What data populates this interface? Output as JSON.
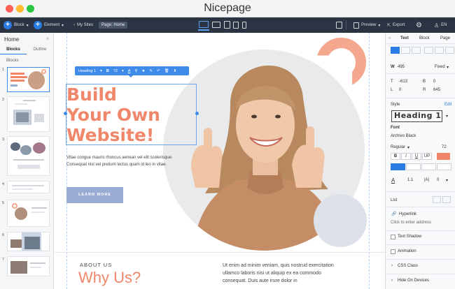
{
  "window": {
    "title": "Nicepage"
  },
  "toolbar": {
    "block_label": "Block",
    "element_label": "Element",
    "my_sites_label": "My Sites",
    "page_label": "Page: Home",
    "preview_label": "Preview",
    "export_label": "Export",
    "lang_label": "EN"
  },
  "left_panel": {
    "title": "Home",
    "tabs": [
      "Blocks",
      "Outline"
    ],
    "section_label": "Blocks",
    "thumbnails": [
      "1",
      "2",
      "3",
      "4",
      "5",
      "6",
      "7"
    ]
  },
  "canvas": {
    "heading_toolbar_label": "Heading 1",
    "heading_toolbar_size": "72",
    "heading_lines": [
      "Build",
      "Your Own",
      "Website!"
    ],
    "paragraph": "Vitae congue mauris rhoncus aenean vel elit scelerisque. Consequat nisl vel pretium lectus quam id leo in vitae.",
    "button_label": "LEARN MORE",
    "about_label": "ABOUT US",
    "why_heading": "Why Us?",
    "about_text": "Ut enim ad minim veniam, quis nostrud exercitation ullamco laboris nisi ut aliquip ex ea commodo consequat. Duis aute irure dolor in"
  },
  "right_panel": {
    "tabs": [
      "Text",
      "Block",
      "Page"
    ],
    "w_label": "W",
    "w_value": "495",
    "w_mode": "Fixed",
    "t_label": "T",
    "t_value": "-613",
    "b_label": "B",
    "b_value": "0",
    "l_label": "L",
    "l_value": "0",
    "r_label": "R",
    "r_value": "645",
    "style_label": "Style",
    "edit_label": "Edit",
    "style_value": "Heading 1",
    "font_label": "Font",
    "font_value": "Archivo Black",
    "weight_value": "Regular",
    "size_value": "72",
    "format_buttons": [
      "B",
      "I",
      "U",
      "UP"
    ],
    "line_height": "1.1",
    "letter_spacing": "0",
    "list_label": "List",
    "hyperlink_label": "Hyperlink",
    "hyperlink_placeholder": "Click to enter address",
    "text_shadow_label": "Text Shadow",
    "animation_label": "Animation",
    "css_class_label": "CSS Class",
    "hide_devices_label": "Hide On Devices"
  },
  "colors": {
    "accent_blue": "#2b7be4",
    "coral": "#f0876a",
    "toolbar_bg": "#2b3443",
    "button_blue": "#97abd3"
  }
}
